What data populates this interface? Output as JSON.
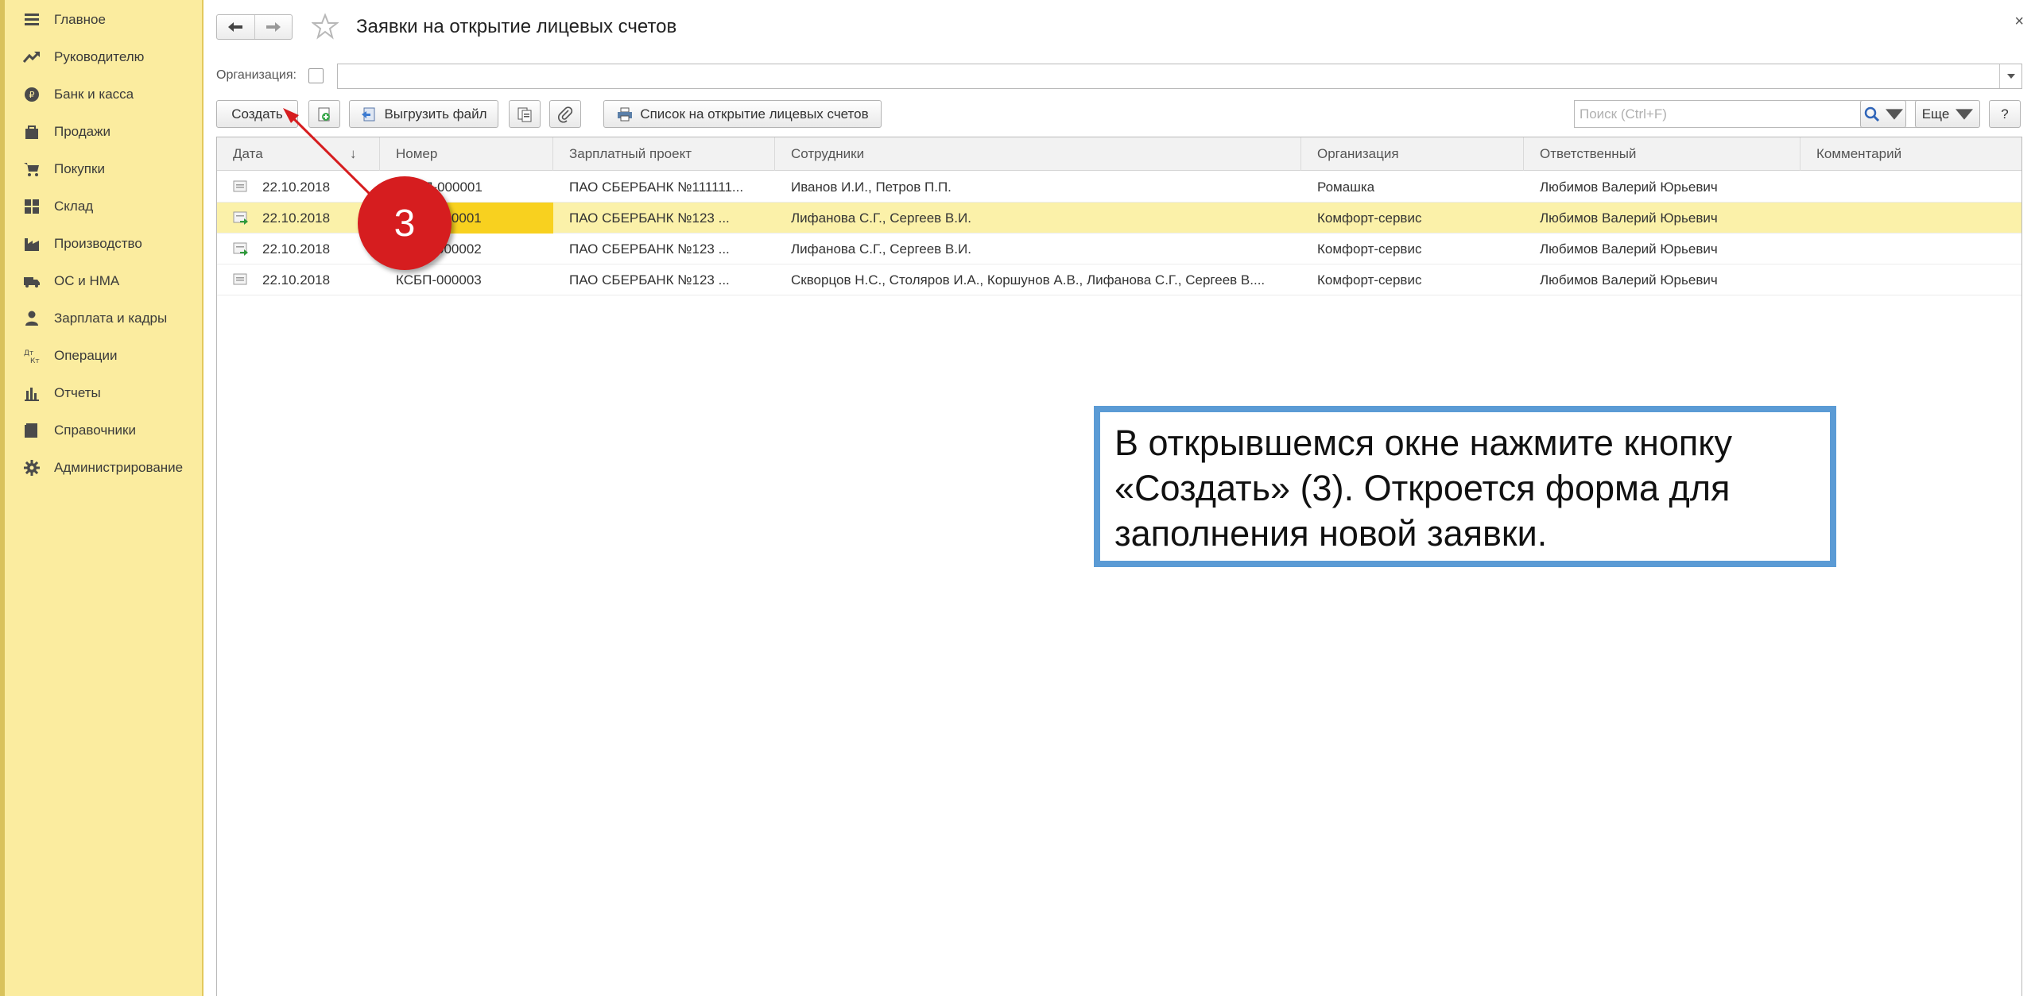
{
  "sidebar": {
    "items": [
      {
        "label": "Главное",
        "icon": "menu-icon"
      },
      {
        "label": "Руководителю",
        "icon": "trend-icon"
      },
      {
        "label": "Банк и касса",
        "icon": "coin-icon"
      },
      {
        "label": "Продажи",
        "icon": "bag-icon"
      },
      {
        "label": "Покупки",
        "icon": "cart-icon"
      },
      {
        "label": "Склад",
        "icon": "grid-icon"
      },
      {
        "label": "Производство",
        "icon": "factory-icon"
      },
      {
        "label": "ОС и НМА",
        "icon": "truck-icon"
      },
      {
        "label": "Зарплата и кадры",
        "icon": "person-icon"
      },
      {
        "label": "Операции",
        "icon": "operations-icon"
      },
      {
        "label": "Отчеты",
        "icon": "bar-chart-icon"
      },
      {
        "label": "Справочники",
        "icon": "book-icon"
      },
      {
        "label": "Администрирование",
        "icon": "gear-icon"
      }
    ]
  },
  "header": {
    "title": "Заявки на открытие лицевых счетов"
  },
  "filter": {
    "organization_label": "Организация:",
    "organization_value": ""
  },
  "toolbar": {
    "create_label": "Создать",
    "export_label": "Выгрузить файл",
    "list_label": "Список на открытие лицевых счетов",
    "search_placeholder": "Поиск (Ctrl+F)",
    "clear_label": "×",
    "more_label": "Еще",
    "help_label": "?"
  },
  "table": {
    "columns": [
      "Дата",
      "Номер",
      "Зарплатный проект",
      "Сотрудники",
      "Организация",
      "Ответственный",
      "Комментарий"
    ],
    "sort_indicator": "↓",
    "rows": [
      {
        "date": "22.10.2018",
        "number": "ВСБП-000001",
        "project": "ПАО СБЕРБАНК №111111...",
        "employees": "Иванов И.И., Петров П.П.",
        "org": "Ромашка",
        "responsible": "Любимов Валерий Юрьевич",
        "comment": "",
        "icon": "document-icon"
      },
      {
        "date": "22.10.2018",
        "number": "КСБП-000001",
        "project": "ПАО СБЕРБАНК №123      ...",
        "employees": "Лифанова С.Г., Сергеев В.И.",
        "org": "Комфорт-сервис",
        "responsible": "Любимов Валерий Юрьевич",
        "comment": "",
        "icon": "posted-document-icon"
      },
      {
        "date": "22.10.2018",
        "number": "КСБП-000002",
        "project": "ПАО СБЕРБАНК №123      ...",
        "employees": "Лифанова С.Г., Сергеев В.И.",
        "org": "Комфорт-сервис",
        "responsible": "Любимов Валерий Юрьевич",
        "comment": "",
        "icon": "posted-document-icon"
      },
      {
        "date": "22.10.2018",
        "number": "КСБП-000003",
        "project": "ПАО СБЕРБАНК №123      ...",
        "employees": "Скворцов Н.С., Столяров И.А., Коршунов А.В., Лифанова С.Г., Сергеев В....",
        "org": "Комфорт-сервис",
        "responsible": "Любимов Валерий Юрьевич",
        "comment": "",
        "icon": "document-icon"
      }
    ]
  },
  "annotation": {
    "step_number": "3",
    "text": "В открывшемся окне нажмите кнопку «Создать» (3). Откроется форма для заполнения новой заявки.",
    "badge_color": "#d61d1f",
    "border_color": "#5b9bd5"
  },
  "colors": {
    "sidebar_bg": "#fbec9f",
    "selected_row": "#fbf1a9",
    "selected_cell": "#f8d11f"
  }
}
